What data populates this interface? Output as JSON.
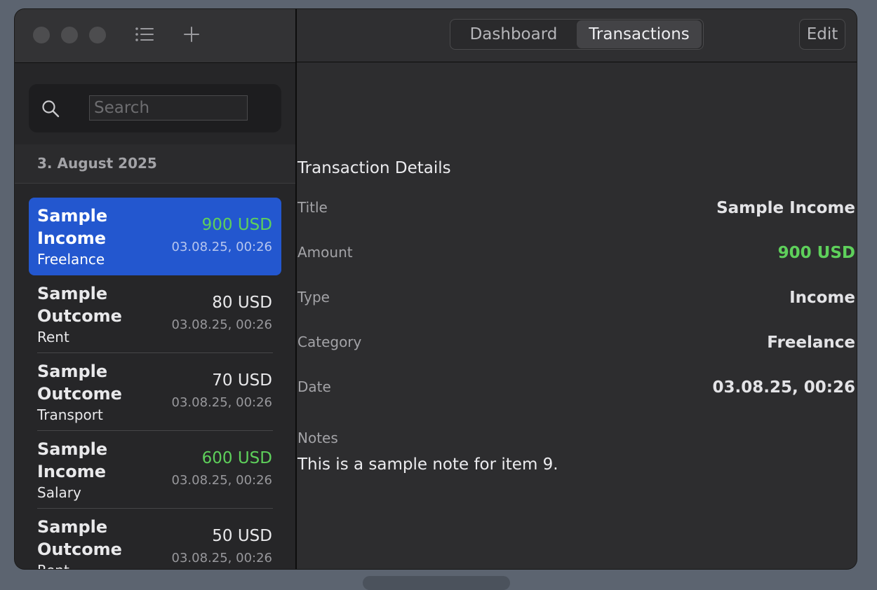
{
  "toolbar": {
    "sidebar_icon": "list-icon",
    "add_icon": "plus-icon"
  },
  "search": {
    "placeholder": "Search",
    "value": ""
  },
  "section": {
    "date": "3. August 2025"
  },
  "transactions": [
    {
      "title": "Sample Income",
      "category": "Freelance",
      "amount": "900 USD",
      "date": "03.08.25, 00:26",
      "type": "income",
      "selected": true
    },
    {
      "title": "Sample Outcome",
      "category": "Rent",
      "amount": "80 USD",
      "date": "03.08.25, 00:26",
      "type": "outcome",
      "selected": false
    },
    {
      "title": "Sample Outcome",
      "category": "Transport",
      "amount": "70 USD",
      "date": "03.08.25, 00:26",
      "type": "outcome",
      "selected": false
    },
    {
      "title": "Sample Income",
      "category": "Salary",
      "amount": "600 USD",
      "date": "03.08.25, 00:26",
      "type": "income",
      "selected": false
    },
    {
      "title": "Sample Outcome",
      "category": "Rent",
      "amount": "50 USD",
      "date": "03.08.25, 00:26",
      "type": "outcome",
      "selected": false
    }
  ],
  "tabs": [
    {
      "label": "Dashboard",
      "active": false
    },
    {
      "label": "Transactions",
      "active": true
    }
  ],
  "edit_label": "Edit",
  "details": {
    "heading": "Transaction Details",
    "rows": [
      {
        "label": "Title",
        "value": "Sample Income"
      },
      {
        "label": "Amount",
        "value": "900 USD"
      },
      {
        "label": "Type",
        "value": "Income"
      },
      {
        "label": "Category",
        "value": "Freelance"
      },
      {
        "label": "Date",
        "value": "03.08.25, 00:26"
      }
    ],
    "notes_label": "Notes",
    "notes_text": "This is a sample note for item 9."
  },
  "colors": {
    "income": "#5ed05b",
    "selection": "#2357cf"
  }
}
